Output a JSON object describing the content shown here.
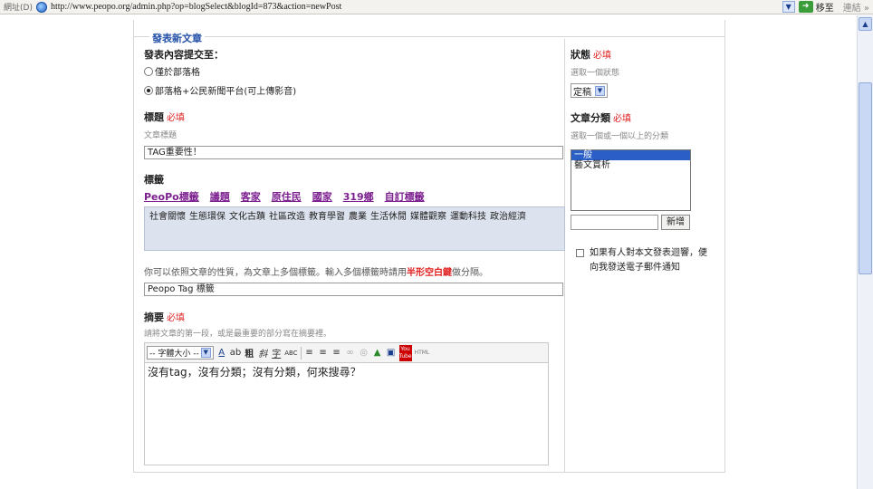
{
  "browser": {
    "address_label": "網址(D)",
    "url": "http://www.peopo.org/admin.php?op=blogSelect&blogId=873&action=newPost",
    "go_label": "移至",
    "links_label": "連結 »"
  },
  "frame": {
    "title": "發表新文章"
  },
  "post_to": {
    "label": "發表內容提交至：",
    "options": [
      {
        "label": "僅於部落格",
        "checked": false
      },
      {
        "label": "部落格+公民新聞平台(可上傳影音)",
        "checked": true
      }
    ]
  },
  "title_field": {
    "label": "標題",
    "required": "必填",
    "hint": "文章標題",
    "value": "TAG重要性！"
  },
  "tags": {
    "label": "標籤",
    "nav": [
      "PeoPo標籤",
      "議題",
      "客家",
      "原住民",
      "國家",
      "319鄉",
      "自訂標籤"
    ],
    "items": [
      "社會關懷",
      "生態環保",
      "文化古蹟",
      "社區改造",
      "教育學習",
      "農業",
      "生活休閒",
      "媒體觀察",
      "運動科技",
      "政治經濟"
    ],
    "note_before": "你可以依照文章的性質，為文章上多個標籤。輸入多個標籤時請用",
    "note_highlight": "半形空白鍵",
    "note_after": "做分隔。",
    "value": "Peopo Tag  標籤"
  },
  "summary": {
    "label": "摘要",
    "required": "必填",
    "hint": "請將文章的第一段，或是最重要的部分寫在摘要裡。",
    "font_size_select": "-- 字體大小 --",
    "toolbar_buttons": [
      "A",
      "ab",
      "粗",
      "斜",
      "字",
      "ABC",
      "≡",
      "≡",
      "≡",
      "∞",
      "◎",
      "▲",
      "▣",
      "You Tube",
      "HTML"
    ],
    "content": "沒有tag，沒有分類；沒有分類，何來搜尋？"
  },
  "status": {
    "label": "狀態",
    "required": "必填",
    "hint": "選取一個狀態",
    "value": "定稿"
  },
  "category": {
    "label": "文章分類",
    "required": "必填",
    "hint": "選取一個或一個以上的分類",
    "options": [
      {
        "label": "一般",
        "selected": true
      },
      {
        "label": "藝文賞析",
        "selected": false
      }
    ],
    "add_button": "新增",
    "new_value": ""
  },
  "notify": {
    "label": "如果有人對本文發表迴響，便向我發送電子郵件通知",
    "checked": false
  }
}
